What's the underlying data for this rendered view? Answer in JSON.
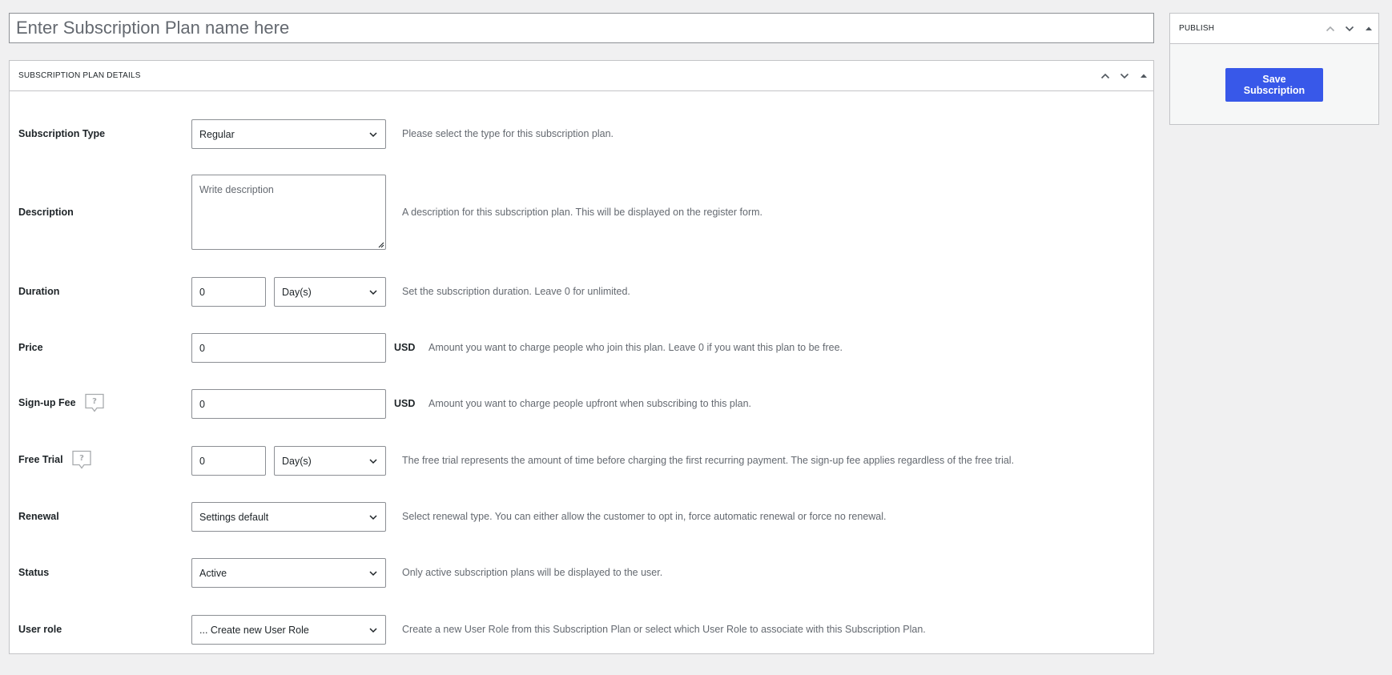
{
  "title_field": {
    "placeholder": "Enter Subscription Plan name here"
  },
  "details_box": {
    "title": "SUBSCRIPTION PLAN DETAILS",
    "fields": {
      "subscription_type": {
        "label": "Subscription Type",
        "value": "Regular",
        "description": "Please select the type for this subscription plan."
      },
      "description": {
        "label": "Description",
        "placeholder": "Write description",
        "description": "A description for this subscription plan. This will be displayed on the register form."
      },
      "duration": {
        "label": "Duration",
        "value": "0",
        "unit": "Day(s)",
        "description": "Set the subscription duration. Leave 0 for unlimited."
      },
      "price": {
        "label": "Price",
        "value": "0",
        "currency": "USD",
        "description": "Amount you want to charge people who join this plan. Leave 0 if you want this plan to be free."
      },
      "signup_fee": {
        "label": "Sign-up Fee",
        "value": "0",
        "currency": "USD",
        "description": "Amount you want to charge people upfront when subscribing to this plan."
      },
      "free_trial": {
        "label": "Free Trial",
        "value": "0",
        "unit": "Day(s)",
        "description": "The free trial represents the amount of time before charging the first recurring payment. The sign-up fee applies regardless of the free trial."
      },
      "renewal": {
        "label": "Renewal",
        "value": "Settings default",
        "description": "Select renewal type. You can either allow the customer to opt in, force automatic renewal or force no renewal."
      },
      "status": {
        "label": "Status",
        "value": "Active",
        "description": "Only active subscription plans will be displayed to the user."
      },
      "user_role": {
        "label": "User role",
        "value": "... Create new User Role",
        "description": "Create a new User Role from this Subscription Plan or select which User Role to associate with this Subscription Plan."
      }
    }
  },
  "publish_box": {
    "title": "PUBLISH",
    "save_label": "Save Subscription"
  },
  "colors": {
    "accent": "#3858e9",
    "background": "#f0f0f1",
    "border": "#c3c4c7",
    "muted_text": "#646970"
  },
  "icons": [
    "chevron-up-icon",
    "chevron-down-icon",
    "toggle-arrow-icon",
    "help-bubble-icon",
    "dropdown-chevron-icon",
    "resize-grip-icon"
  ]
}
